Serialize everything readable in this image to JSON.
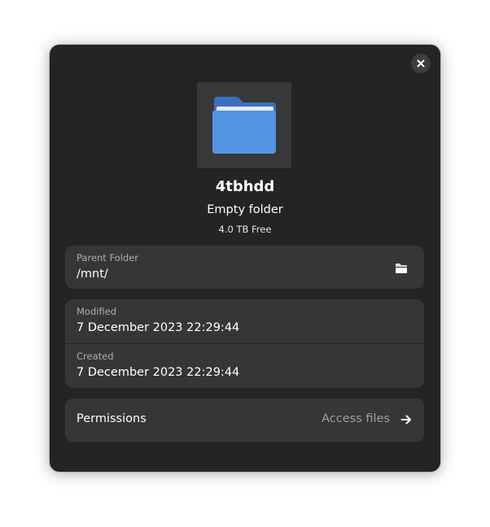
{
  "folder": {
    "name": "4tbhdd",
    "description": "Empty folder",
    "free_space": "4.0 TB Free",
    "icon": "folder-icon",
    "icon_color": "#5294e2"
  },
  "location": {
    "label": "Parent Folder",
    "value": "/mnt/",
    "action_icon": "open-folder-icon"
  },
  "times": {
    "modified_label": "Modified",
    "modified_value": "7 December 2023 22:29:44",
    "created_label": "Created",
    "created_value": "7 December 2023 22:29:44"
  },
  "permissions": {
    "label": "Permissions",
    "value": "Access files",
    "action_icon": "arrow-right-icon"
  },
  "window": {
    "close_icon": "close-icon",
    "background": "#242424",
    "card_background": "#363636"
  }
}
